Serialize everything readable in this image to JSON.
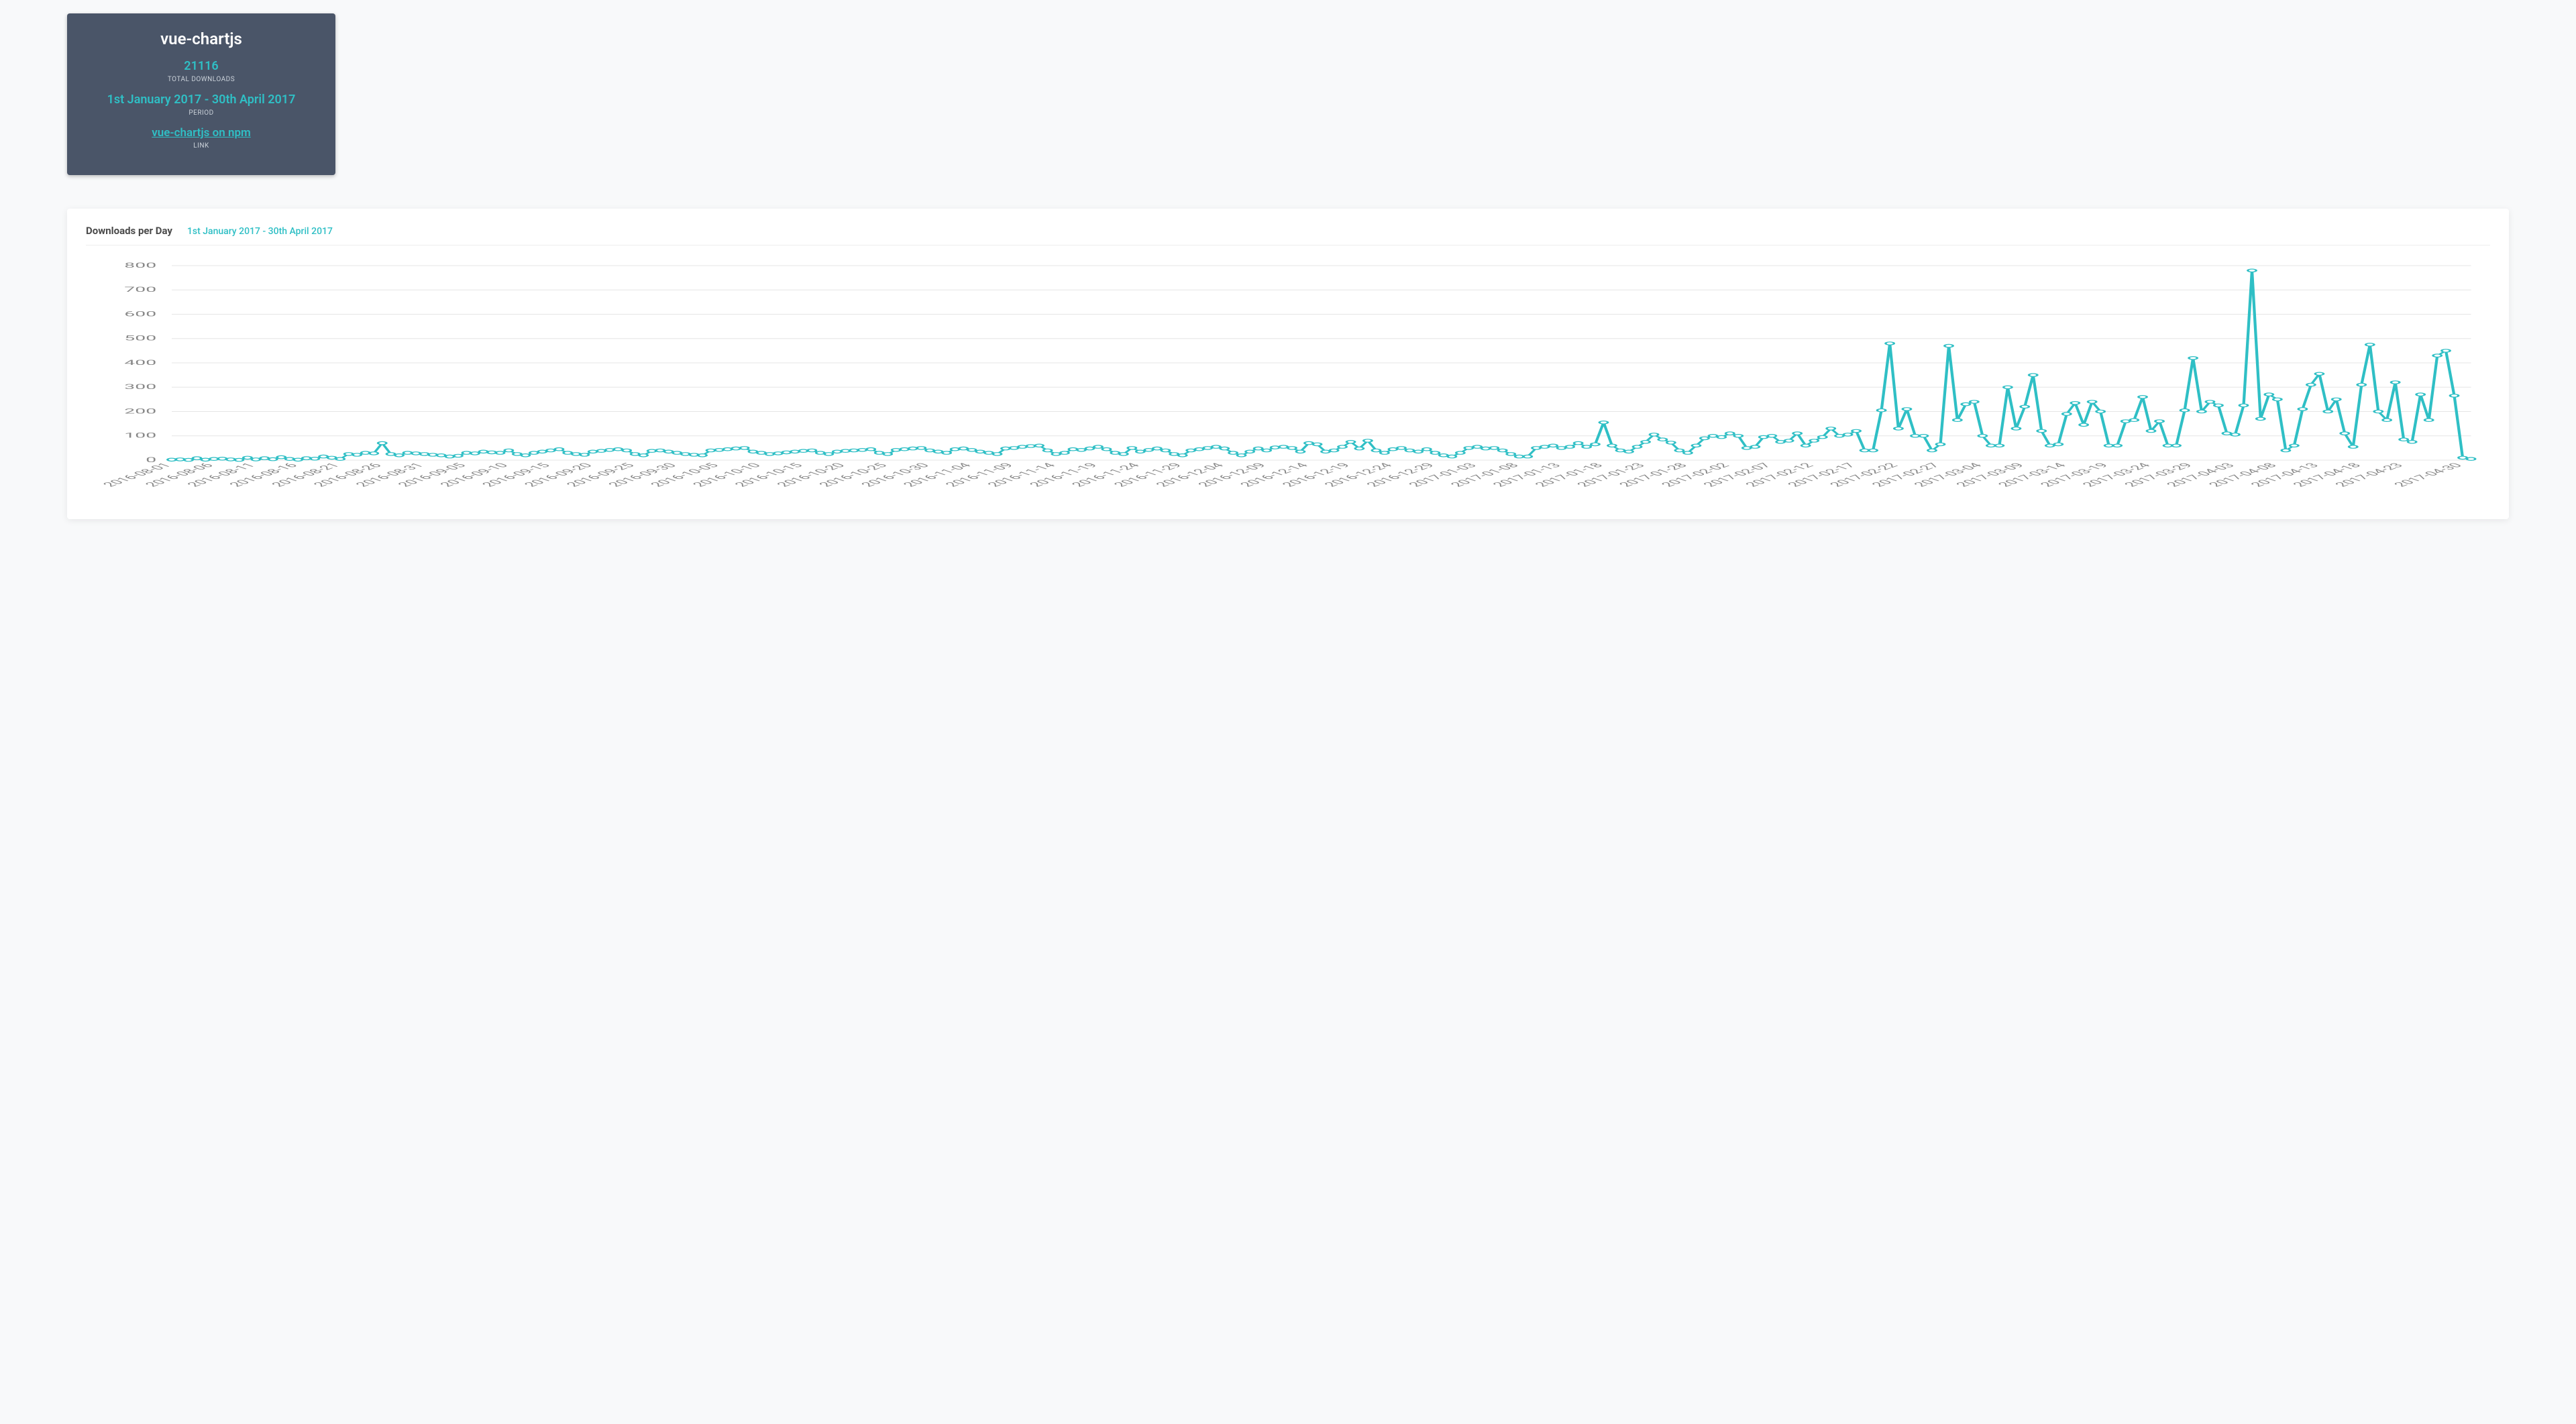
{
  "card": {
    "title": "vue-chartjs",
    "total_downloads": "21116",
    "total_downloads_label": "TOTAL DOWNLOADS",
    "period": "1st January 2017 - 30th April 2017",
    "period_label": "PERIOD",
    "link_text": "vue-chartjs on npm",
    "link_label": "LINK"
  },
  "chart_header": {
    "title": "Downloads per Day",
    "period": "1st January 2017 - 30th April 2017"
  },
  "chart_data": {
    "type": "line",
    "title": "Downloads per Day",
    "xlabel": "",
    "ylabel": "",
    "ylim": [
      0,
      800
    ],
    "yticks": [
      0,
      100,
      200,
      300,
      400,
      500,
      600,
      700,
      800
    ],
    "xtick_labels": [
      "2016-08-01",
      "2016-08-06",
      "2016-08-11",
      "2016-08-16",
      "2016-08-21",
      "2016-08-26",
      "2016-08-31",
      "2016-09-05",
      "2016-09-10",
      "2016-09-15",
      "2016-09-20",
      "2016-09-25",
      "2016-09-30",
      "2016-10-05",
      "2016-10-10",
      "2016-10-15",
      "2016-10-20",
      "2016-10-25",
      "2016-10-30",
      "2016-11-04",
      "2016-11-09",
      "2016-11-14",
      "2016-11-19",
      "2016-11-24",
      "2016-11-29",
      "2016-12-04",
      "2016-12-09",
      "2016-12-14",
      "2016-12-19",
      "2016-12-24",
      "2016-12-29",
      "2017-01-03",
      "2017-01-08",
      "2017-01-13",
      "2017-01-18",
      "2017-01-23",
      "2017-01-28",
      "2017-02-02",
      "2017-02-07",
      "2017-02-12",
      "2017-02-17",
      "2017-02-22",
      "2017-02-27",
      "2017-03-04",
      "2017-03-09",
      "2017-03-14",
      "2017-03-19",
      "2017-03-24",
      "2017-03-29",
      "2017-04-03",
      "2017-04-08",
      "2017-04-13",
      "2017-04-18",
      "2017-04-23",
      "2017-04-30"
    ],
    "x": [
      "2016-08-01",
      "2016-08-02",
      "2016-08-03",
      "2016-08-04",
      "2016-08-05",
      "2016-08-06",
      "2016-08-07",
      "2016-08-08",
      "2016-08-09",
      "2016-08-10",
      "2016-08-11",
      "2016-08-12",
      "2016-08-13",
      "2016-08-14",
      "2016-08-15",
      "2016-08-16",
      "2016-08-17",
      "2016-08-18",
      "2016-08-19",
      "2016-08-20",
      "2016-08-21",
      "2016-08-22",
      "2016-08-23",
      "2016-08-24",
      "2016-08-25",
      "2016-08-26",
      "2016-08-27",
      "2016-08-28",
      "2016-08-29",
      "2016-08-30",
      "2016-08-31",
      "2016-09-01",
      "2016-09-02",
      "2016-09-03",
      "2016-09-04",
      "2016-09-05",
      "2016-09-06",
      "2016-09-07",
      "2016-09-08",
      "2016-09-09",
      "2016-09-10",
      "2016-09-11",
      "2016-09-12",
      "2016-09-13",
      "2016-09-14",
      "2016-09-15",
      "2016-09-16",
      "2016-09-17",
      "2016-09-18",
      "2016-09-19",
      "2016-09-20",
      "2016-09-21",
      "2016-09-22",
      "2016-09-23",
      "2016-09-24",
      "2016-09-25",
      "2016-09-26",
      "2016-09-27",
      "2016-09-28",
      "2016-09-29",
      "2016-09-30",
      "2016-10-01",
      "2016-10-02",
      "2016-10-03",
      "2016-10-04",
      "2016-10-05",
      "2016-10-06",
      "2016-10-07",
      "2016-10-08",
      "2016-10-09",
      "2016-10-10",
      "2016-10-11",
      "2016-10-12",
      "2016-10-13",
      "2016-10-14",
      "2016-10-15",
      "2016-10-16",
      "2016-10-17",
      "2016-10-18",
      "2016-10-19",
      "2016-10-20",
      "2016-10-21",
      "2016-10-22",
      "2016-10-23",
      "2016-10-24",
      "2016-10-25",
      "2016-10-26",
      "2016-10-27",
      "2016-10-28",
      "2016-10-29",
      "2016-10-30",
      "2016-10-31",
      "2016-11-01",
      "2016-11-02",
      "2016-11-03",
      "2016-11-04",
      "2016-11-05",
      "2016-11-06",
      "2016-11-07",
      "2016-11-08",
      "2016-11-09",
      "2016-11-10",
      "2016-11-11",
      "2016-11-12",
      "2016-11-13",
      "2016-11-14",
      "2016-11-15",
      "2016-11-16",
      "2016-11-17",
      "2016-11-18",
      "2016-11-19",
      "2016-11-20",
      "2016-11-21",
      "2016-11-22",
      "2016-11-23",
      "2016-11-24",
      "2016-11-25",
      "2016-11-26",
      "2016-11-27",
      "2016-11-28",
      "2016-11-29",
      "2016-11-30",
      "2016-12-01",
      "2016-12-02",
      "2016-12-03",
      "2016-12-04",
      "2016-12-05",
      "2016-12-06",
      "2016-12-07",
      "2016-12-08",
      "2016-12-09",
      "2016-12-10",
      "2016-12-11",
      "2016-12-12",
      "2016-12-13",
      "2016-12-14",
      "2016-12-15",
      "2016-12-16",
      "2016-12-17",
      "2016-12-18",
      "2016-12-19",
      "2016-12-20",
      "2016-12-21",
      "2016-12-22",
      "2016-12-23",
      "2016-12-24",
      "2016-12-25",
      "2016-12-26",
      "2016-12-27",
      "2016-12-28",
      "2016-12-29",
      "2016-12-30",
      "2016-12-31",
      "2017-01-01",
      "2017-01-02",
      "2017-01-03",
      "2017-01-04",
      "2017-01-05",
      "2017-01-06",
      "2017-01-07",
      "2017-01-08",
      "2017-01-09",
      "2017-01-10",
      "2017-01-11",
      "2017-01-12",
      "2017-01-13",
      "2017-01-14",
      "2017-01-15",
      "2017-01-16",
      "2017-01-17",
      "2017-01-18",
      "2017-01-19",
      "2017-01-20",
      "2017-01-21",
      "2017-01-22",
      "2017-01-23",
      "2017-01-24",
      "2017-01-25",
      "2017-01-26",
      "2017-01-27",
      "2017-01-28",
      "2017-01-29",
      "2017-01-30",
      "2017-01-31",
      "2017-02-01",
      "2017-02-02",
      "2017-02-03",
      "2017-02-04",
      "2017-02-05",
      "2017-02-06",
      "2017-02-07",
      "2017-02-08",
      "2017-02-09",
      "2017-02-10",
      "2017-02-11",
      "2017-02-12",
      "2017-02-13",
      "2017-02-14",
      "2017-02-15",
      "2017-02-16",
      "2017-02-17",
      "2017-02-18",
      "2017-02-19",
      "2017-02-20",
      "2017-02-21",
      "2017-02-22",
      "2017-02-23",
      "2017-02-24",
      "2017-02-25",
      "2017-02-26",
      "2017-02-27",
      "2017-02-28",
      "2017-03-01",
      "2017-03-02",
      "2017-03-03",
      "2017-03-04",
      "2017-03-05",
      "2017-03-06",
      "2017-03-07",
      "2017-03-08",
      "2017-03-09",
      "2017-03-10",
      "2017-03-11",
      "2017-03-12",
      "2017-03-13",
      "2017-03-14",
      "2017-03-15",
      "2017-03-16",
      "2017-03-17",
      "2017-03-18",
      "2017-03-19",
      "2017-03-20",
      "2017-03-21",
      "2017-03-22",
      "2017-03-23",
      "2017-03-24",
      "2017-03-25",
      "2017-03-26",
      "2017-03-27",
      "2017-03-28",
      "2017-03-29",
      "2017-03-30",
      "2017-03-31",
      "2017-04-01",
      "2017-04-02",
      "2017-04-03",
      "2017-04-04",
      "2017-04-05",
      "2017-04-06",
      "2017-04-07",
      "2017-04-08",
      "2017-04-09",
      "2017-04-10",
      "2017-04-11",
      "2017-04-12",
      "2017-04-13",
      "2017-04-14",
      "2017-04-15",
      "2017-04-16",
      "2017-04-17",
      "2017-04-18",
      "2017-04-19",
      "2017-04-20",
      "2017-04-21",
      "2017-04-22",
      "2017-04-23",
      "2017-04-24",
      "2017-04-25",
      "2017-04-26",
      "2017-04-27",
      "2017-04-28",
      "2017-04-29",
      "2017-04-30"
    ],
    "values": [
      2,
      3,
      1,
      8,
      2,
      5,
      6,
      3,
      1,
      10,
      3,
      8,
      4,
      12,
      5,
      2,
      8,
      6,
      15,
      10,
      5,
      25,
      22,
      30,
      28,
      70,
      25,
      20,
      30,
      28,
      25,
      22,
      20,
      15,
      18,
      30,
      28,
      35,
      32,
      30,
      40,
      25,
      20,
      30,
      35,
      40,
      45,
      30,
      25,
      22,
      35,
      38,
      42,
      45,
      40,
      25,
      20,
      38,
      40,
      35,
      30,
      25,
      22,
      20,
      40,
      42,
      45,
      48,
      50,
      35,
      30,
      25,
      28,
      32,
      35,
      38,
      40,
      30,
      25,
      35,
      38,
      40,
      42,
      45,
      30,
      25,
      42,
      45,
      48,
      50,
      40,
      35,
      30,
      45,
      48,
      42,
      35,
      30,
      25,
      48,
      50,
      55,
      58,
      60,
      40,
      25,
      30,
      45,
      42,
      48,
      55,
      45,
      30,
      25,
      50,
      35,
      42,
      48,
      40,
      25,
      20,
      40,
      45,
      50,
      55,
      48,
      30,
      20,
      35,
      48,
      40,
      52,
      55,
      50,
      35,
      70,
      65,
      35,
      40,
      55,
      75,
      48,
      80,
      40,
      30,
      45,
      50,
      40,
      35,
      45,
      30,
      20,
      15,
      30,
      50,
      55,
      48,
      50,
      40,
      25,
      15,
      15,
      50,
      55,
      60,
      50,
      55,
      70,
      55,
      65,
      155,
      60,
      40,
      35,
      55,
      75,
      105,
      85,
      72,
      40,
      30,
      60,
      90,
      100,
      95,
      110,
      100,
      50,
      55,
      95,
      100,
      75,
      80,
      110,
      60,
      80,
      95,
      130,
      100,
      105,
      120,
      40,
      40,
      205,
      480,
      130,
      210,
      100,
      100,
      40,
      65,
      470,
      165,
      230,
      240,
      100,
      60,
      60,
      300,
      130,
      220,
      350,
      120,
      60,
      65,
      190,
      235,
      145,
      240,
      200,
      60,
      60,
      160,
      165,
      260,
      120,
      160,
      60,
      60,
      205,
      420,
      200,
      240,
      225,
      110,
      105,
      225,
      780,
      170,
      270,
      250,
      40,
      60,
      210,
      310,
      355,
      200,
      250,
      110,
      55,
      310,
      475,
      200,
      165,
      320,
      85,
      75,
      270,
      165,
      430,
      450,
      265,
      10,
      5
    ]
  },
  "colors": {
    "accent": "#2fbfc5",
    "card_bg": "#4a5568",
    "grid": "#e6e6e6",
    "axis_text": "#888"
  }
}
